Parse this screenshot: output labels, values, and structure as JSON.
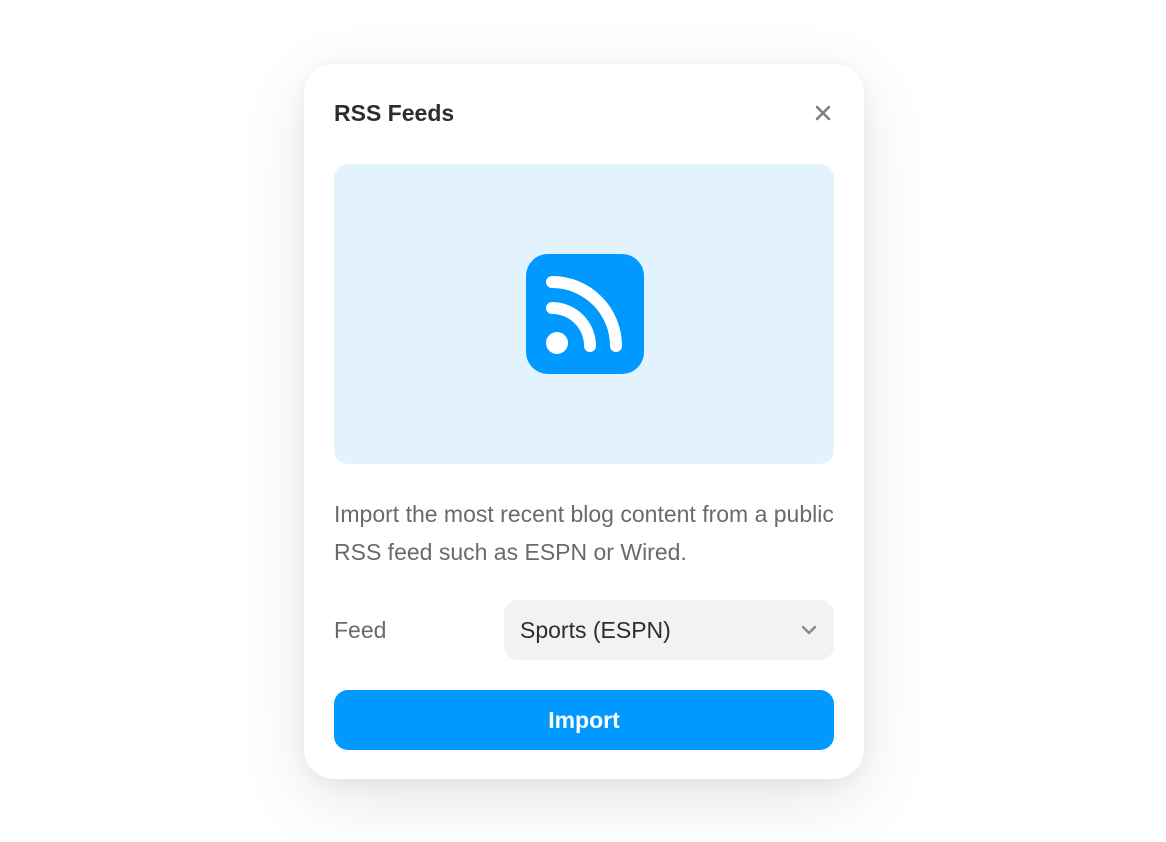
{
  "dialog": {
    "title": "RSS Feeds",
    "close_icon": "close-icon",
    "hero_icon": "rss-icon",
    "description": "Import the most recent blog content from a public RSS feed such as ESPN or Wired.",
    "feed_label": "Feed",
    "feed_select": {
      "value": "Sports (ESPN)",
      "icon": "chevron-down-icon"
    },
    "import_label": "Import"
  },
  "colors": {
    "accent": "#0099ff",
    "hero_background": "#e3f3fd",
    "select_background": "#f2f2f2",
    "title_text": "#2d2d2d",
    "body_text": "#6a6a6a"
  }
}
